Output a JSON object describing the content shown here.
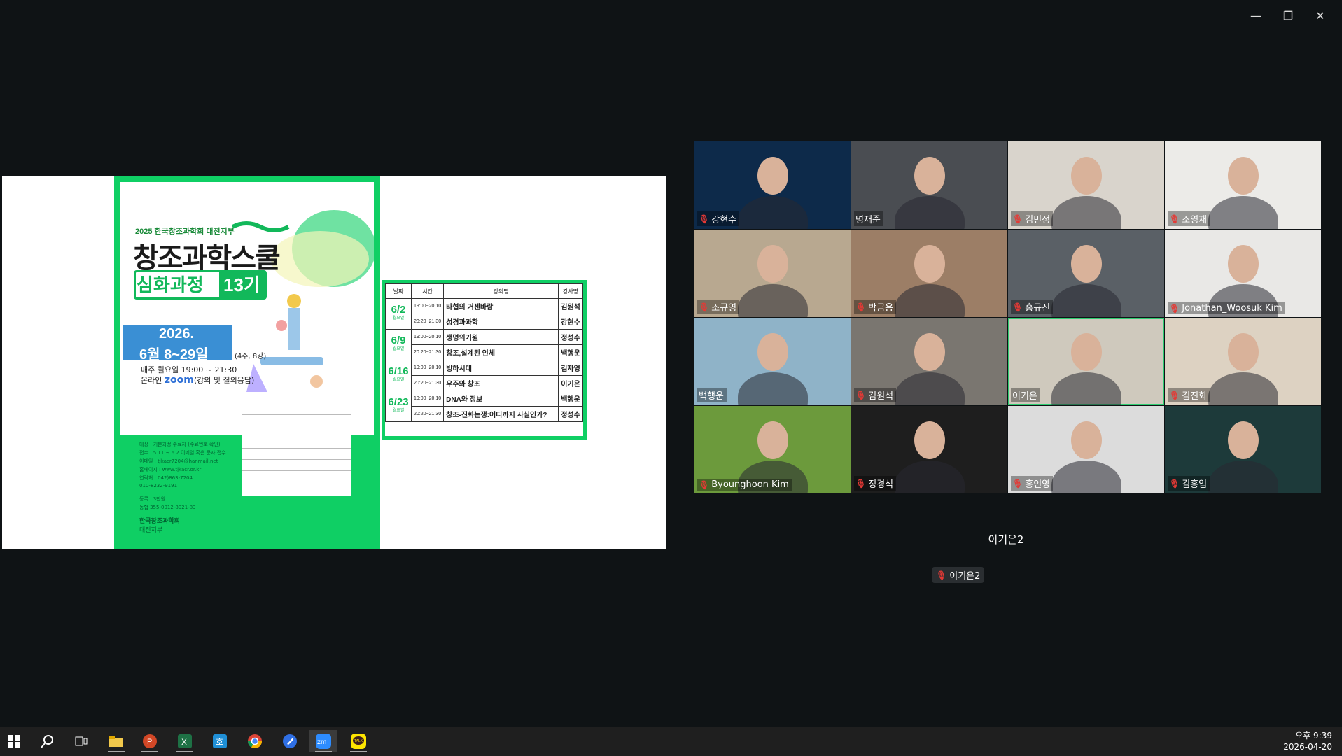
{
  "window_controls": [
    "—",
    "❐",
    "✕"
  ],
  "poster": {
    "org": "2025 한국창조과학회 대전지부",
    "title": "창조과학스쿨",
    "subtitle": "심화과정",
    "generation": "13기",
    "date_line1": "2026.",
    "date_line2": "6월 8~29일",
    "date_note": "(4주, 8강)",
    "weekly": "매주 월요일 19:00 ~ 21:30",
    "online_prefix": "온라인",
    "online_brand": "zoom",
    "online_suffix": "(강의 및 질의응답)",
    "info_lines": [
      "대상 | 기본과정 수료자 (수료번호 확인)",
      "접수 | 5.11 ~ 6.2 이메일 혹은 문자 접수",
      "이메일 : tjkacr7204@hanmail.net",
      "홈페이지 : www.tjkacr.or.kr",
      "연락처 : 042)863-7204",
      "010-8232-9191",
      "등록 | 3만원",
      "농협 355-0012-8021-83"
    ],
    "logo_line1": "한국창조과학회",
    "logo_line2": "대전지부"
  },
  "schedule": {
    "headers": [
      "날짜",
      "시간",
      "강의명",
      "강사명"
    ],
    "rows": [
      {
        "date": "6/2",
        "day": "월요일",
        "time": "19:00~20:10",
        "lecture": "타협의 거센바람",
        "speaker": "김원석"
      },
      {
        "date": "",
        "day": "",
        "time": "20:20~21:30",
        "lecture": "성경과과학",
        "speaker": "강현수"
      },
      {
        "date": "6/9",
        "day": "월요일",
        "time": "19:00~20:10",
        "lecture": "생명의기원",
        "speaker": "정성수"
      },
      {
        "date": "",
        "day": "",
        "time": "20:20~21:30",
        "lecture": "창조,설계된 인체",
        "speaker": "백행운"
      },
      {
        "date": "6/16",
        "day": "월요일",
        "time": "19:00~20:10",
        "lecture": "빙하시대",
        "speaker": "김자영"
      },
      {
        "date": "",
        "day": "",
        "time": "20:20~21:30",
        "lecture": "우주와 창조",
        "speaker": "이기은"
      },
      {
        "date": "6/23",
        "day": "월요일",
        "time": "19:00~20:10",
        "lecture": "DNA와 정보",
        "speaker": "백행운"
      },
      {
        "date": "",
        "day": "",
        "time": "20:20~21:30",
        "lecture": "창조-진화논쟁:어디까지 사실인가?",
        "speaker": "정성수"
      }
    ]
  },
  "participants": [
    {
      "name": "강현수",
      "muted": true,
      "bg": "#0d2a4a"
    },
    {
      "name": "명재준",
      "muted": false,
      "bg": "#4a4d52"
    },
    {
      "name": "김민정",
      "muted": true,
      "bg": "#d9d4cc"
    },
    {
      "name": "조영재",
      "muted": true,
      "bg": "#ecebe8"
    },
    {
      "name": "조규영",
      "muted": true,
      "bg": "#b8a890"
    },
    {
      "name": "박금용",
      "muted": true,
      "bg": "#9c7e66"
    },
    {
      "name": "홍규진",
      "muted": true,
      "bg": "#5a6066"
    },
    {
      "name": "Jonathan_Woosuk Kim",
      "muted": true,
      "bg": "#e9e8e6"
    },
    {
      "name": "백행운",
      "muted": false,
      "bg": "#8fb3c8"
    },
    {
      "name": "김원석",
      "muted": true,
      "bg": "#7a7670"
    },
    {
      "name": "이기은",
      "muted": false,
      "bg": "#cfc9bd"
    },
    {
      "name": "김진화",
      "muted": true,
      "bg": "#ddd2c2"
    },
    {
      "name": "Byounghoon Kim",
      "muted": true,
      "bg": "#6c9a3c"
    },
    {
      "name": "정경식",
      "muted": true,
      "bg": "#1e1e1e"
    },
    {
      "name": "홍인영",
      "muted": true,
      "bg": "#dcdcdc"
    },
    {
      "name": "김홍업",
      "muted": true,
      "bg": "#1d3a3a"
    }
  ],
  "active_speaker": "이기은2",
  "self_name": "이기은2",
  "taskbar": {
    "apps": [
      "start-icon",
      "search-icon",
      "task-view-icon",
      "file-explorer-icon",
      "powerpoint-icon",
      "excel-icon",
      "hancom-icon",
      "chrome-icon",
      "pen-icon",
      "zoom-icon",
      "kakaotalk-icon"
    ],
    "time": "오후 9:39",
    "date": "2026-04-20"
  }
}
